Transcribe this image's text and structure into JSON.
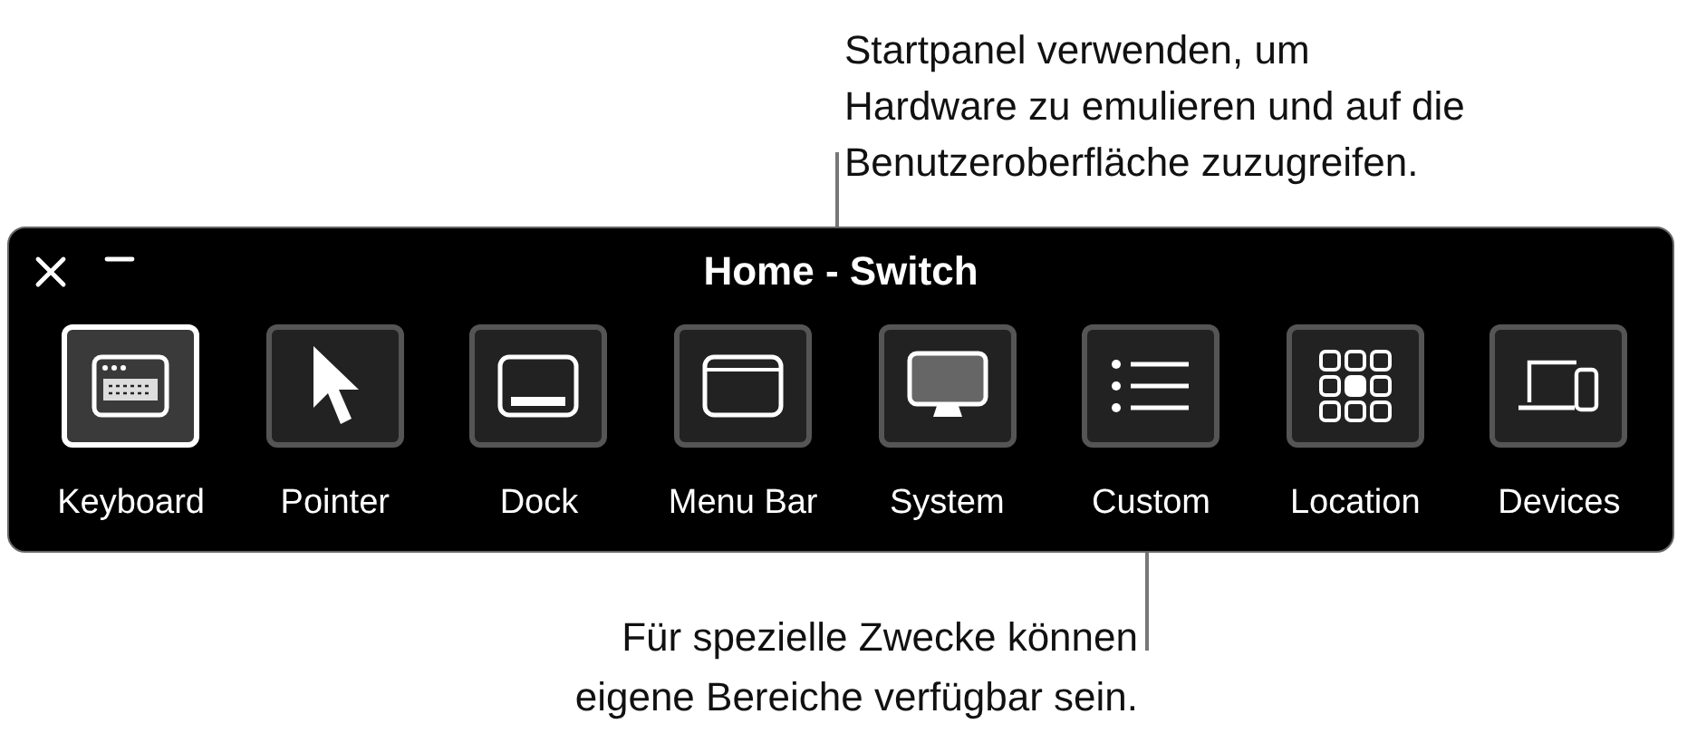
{
  "top_callout": [
    "Startpanel verwenden, um",
    "Hardware zu emulieren und auf die",
    "Benutzeroberfläche zuzugreifen."
  ],
  "window": {
    "title": "Home - Switch"
  },
  "items": [
    {
      "label": "Keyboard",
      "kind": "keyboard",
      "selected": true
    },
    {
      "label": "Pointer",
      "kind": "pointer",
      "selected": false
    },
    {
      "label": "Dock",
      "kind": "dock",
      "selected": false
    },
    {
      "label": "Menu Bar",
      "kind": "menubar",
      "selected": false
    },
    {
      "label": "System",
      "kind": "system",
      "selected": false
    },
    {
      "label": "Custom",
      "kind": "list",
      "selected": false
    },
    {
      "label": "Location",
      "kind": "grid",
      "selected": false
    },
    {
      "label": "Devices",
      "kind": "devices",
      "selected": false
    }
  ],
  "bottom_callout": [
    "Für spezielle Zwecke können",
    "eigene Bereiche verfügbar sein."
  ]
}
